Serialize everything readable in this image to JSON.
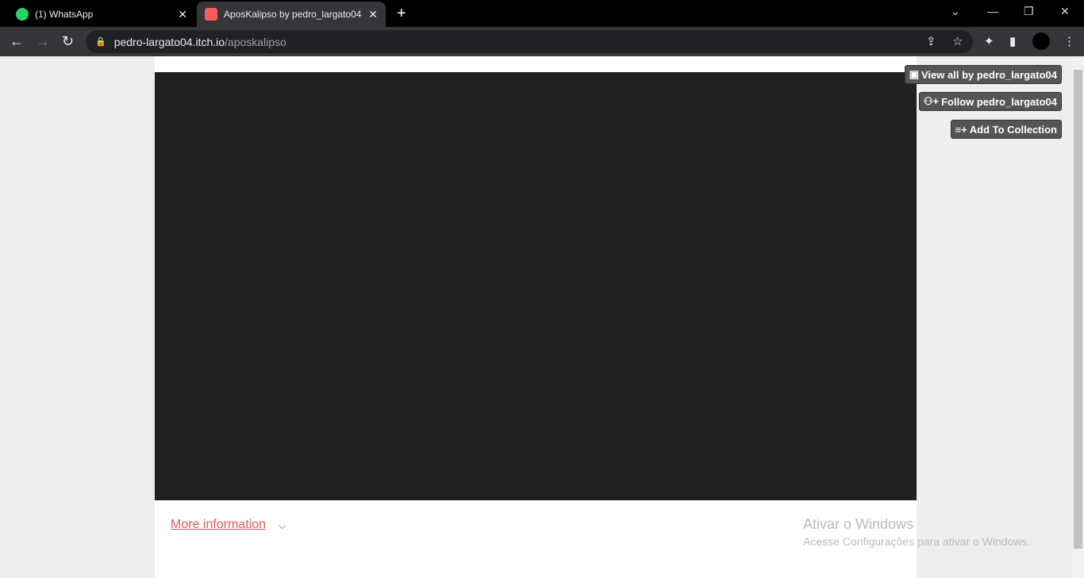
{
  "browser": {
    "tabs": [
      {
        "title": "(1) WhatsApp",
        "icon": "whatsapp-icon"
      },
      {
        "title": "AposKalipso by pedro_largato04",
        "icon": "itchio-icon",
        "active": true
      }
    ],
    "url": {
      "domain": "pedro-largato04.itch.io",
      "path": "/aposkalipso"
    }
  },
  "page": {
    "more_info": "More information",
    "buttons": {
      "view_all": "View all by pedro_largato04",
      "follow": "Follow pedro_largato04",
      "add_collection": "Add To Collection"
    }
  },
  "watermark": {
    "title": "Ativar o Windows",
    "subtitle": "Acesse Configurações para ativar o Windows."
  },
  "colors": {
    "link": "#da5b5b",
    "game_bg": "#202020",
    "button_bg": "#555555"
  }
}
